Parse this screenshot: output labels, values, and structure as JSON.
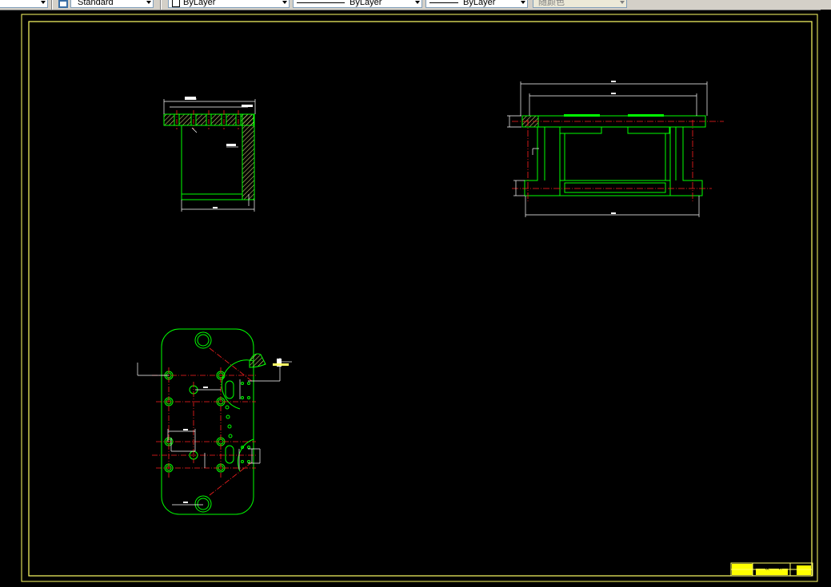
{
  "toolbar": {
    "textstyle_value": "Standard",
    "layer_color_value": "ByLayer",
    "linetype_value": "ByLayer",
    "lineweight_value": "ByLayer",
    "plotstyle_value": "随颜色"
  },
  "colors": {
    "background": "#000000",
    "frame": "#ffff66",
    "part_line": "#00ff00",
    "centerline": "#ff2020",
    "dimension": "#ffffff",
    "hatch": "#c8c870"
  },
  "title_block": {
    "cell_a": "设",
    "cell_b": "计"
  }
}
